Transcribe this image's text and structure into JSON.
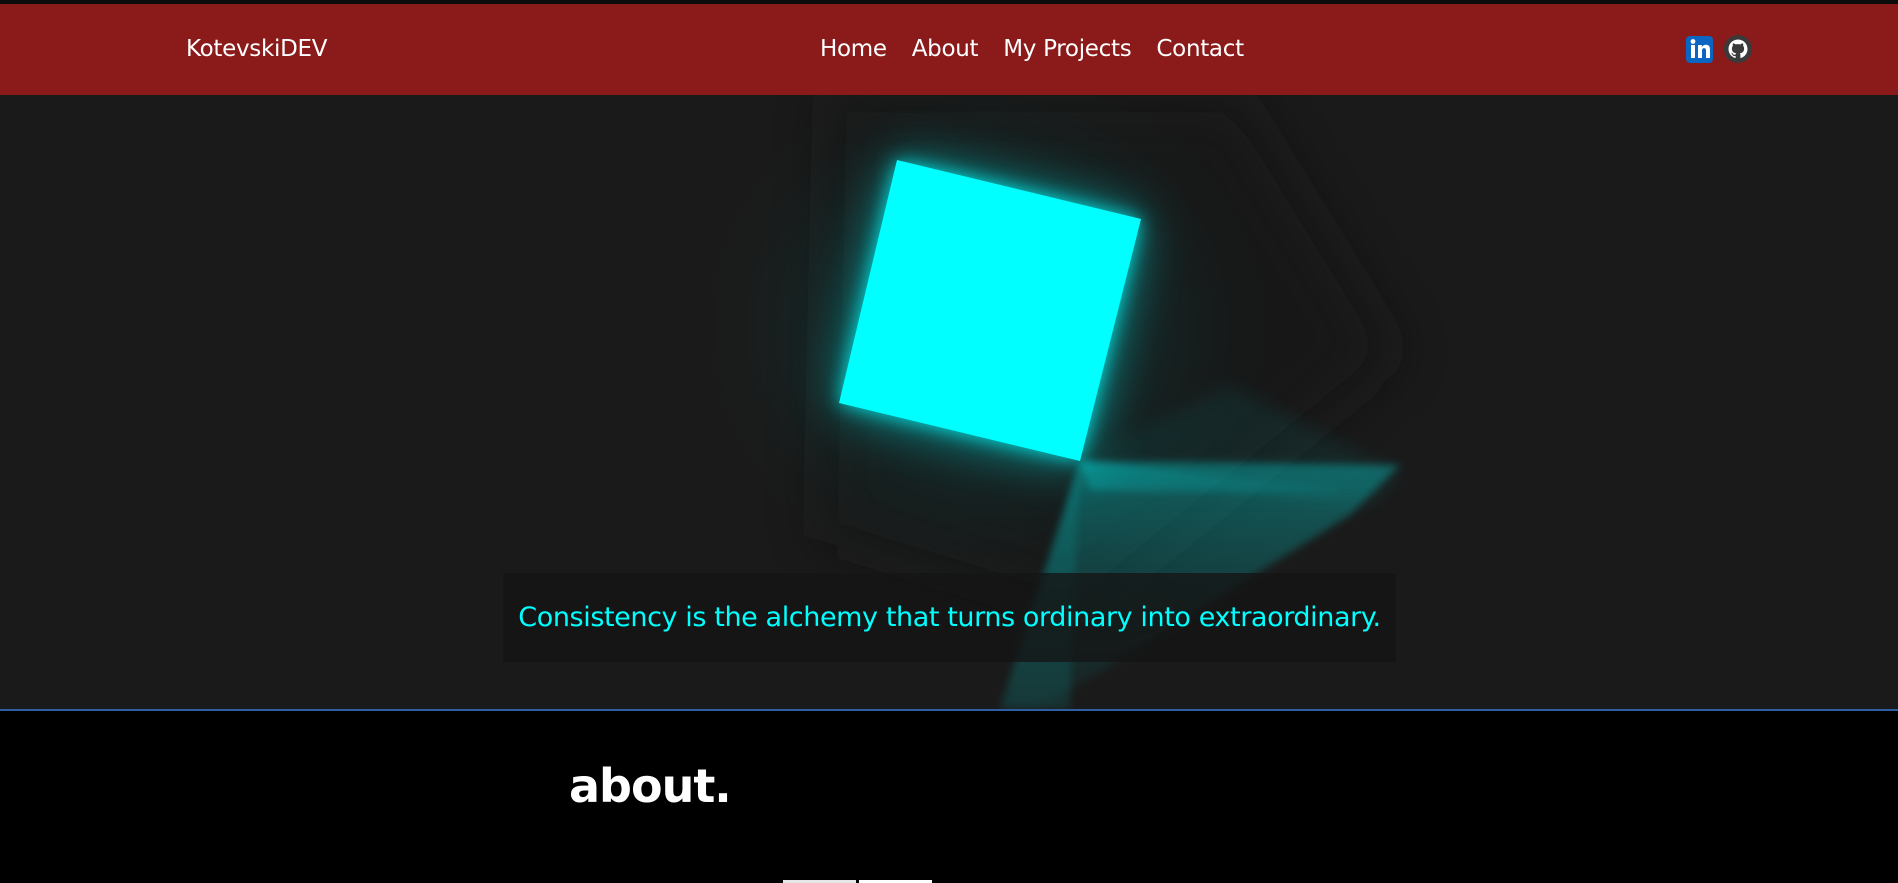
{
  "navbar": {
    "brand": "KotevskiDEV",
    "links": [
      "Home",
      "About",
      "My Projects",
      "Contact"
    ],
    "background_color": "#8b1a1a"
  },
  "social": {
    "icons": [
      "linkedin-icon",
      "github-icon"
    ],
    "linkedin_color": "#0a66c2"
  },
  "hero": {
    "quote": "Consistency is the alchemy that turns ordinary into extraordinary.",
    "accent_color": "#00ffff",
    "background_color": "#1a1a1a"
  },
  "about": {
    "heading": "about."
  }
}
